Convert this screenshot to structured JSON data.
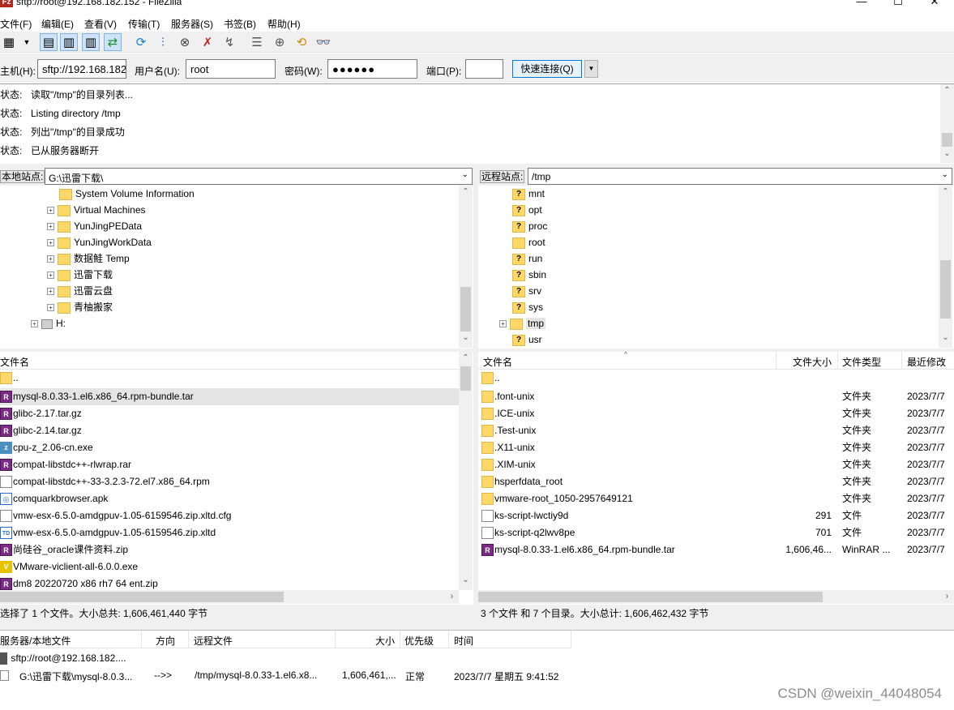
{
  "window": {
    "title": "sftp://root@192.168.182.152 - FileZilla",
    "minimize": "—",
    "maximize": "☐",
    "close": "✕"
  },
  "menu": [
    "文件(F)",
    "编辑(E)",
    "查看(V)",
    "传输(T)",
    "服务器(S)",
    "书签(B)",
    "帮助(H)"
  ],
  "quickconnect": {
    "host_label": "主机(H):",
    "host_value": "sftp://192.168.182",
    "user_label": "用户名(U):",
    "user_value": "root",
    "pass_label": "密码(W):",
    "pass_value": "●●●●●●",
    "port_label": "端口(P):",
    "port_value": "",
    "connect_label": "快速连接(Q)",
    "dropdown": "▼"
  },
  "log": [
    {
      "key": "状态:",
      "text": "读取\"/tmp\"的目录列表..."
    },
    {
      "key": "状态:",
      "text": "Listing directory /tmp"
    },
    {
      "key": "状态:",
      "text": "列出\"/tmp\"的目录成功"
    },
    {
      "key": "状态:",
      "text": "已从服务器断开"
    }
  ],
  "local": {
    "site_label": "本地站点:",
    "path": "G:\\迅雷下载\\",
    "tree": [
      "System Volume Information",
      "Virtual Machines",
      "YunJingPEData",
      "YunJingWorkData",
      "数据鮭 Temp",
      "迅雷下载",
      "迅雷云盘",
      "青柚搬家",
      "H:"
    ],
    "header": {
      "name": "文件名"
    },
    "files": [
      "..",
      "mysql-8.0.33-1.el6.x86_64.rpm-bundle.tar",
      "glibc-2.17.tar.gz",
      "glibc-2.14.tar.gz",
      "cpu-z_2.06-cn.exe",
      "compat-libstdc++-rlwrap.rar",
      "compat-libstdc++-33-3.2.3-72.el7.x86_64.rpm",
      "comquarkbrowser.apk",
      "vmw-esx-6.5.0-amdgpuv-1.05-6159546.zip.xltd.cfg",
      "vmw-esx-6.5.0-amdgpuv-1.05-6159546.zip.xltd",
      "尚硅谷_oracle课件资料.zip",
      "VMware-viclient-all-6.0.0.exe",
      "dm8 20220720 x86 rh7 64 ent.zip"
    ],
    "status": "选择了 1 个文件。大小总共: 1,606,461,440 字节"
  },
  "remote": {
    "site_label": "远程站点:",
    "path": "/tmp",
    "tree": [
      "mnt",
      "opt",
      "proc",
      "root",
      "run",
      "sbin",
      "srv",
      "sys",
      "tmp",
      "usr"
    ],
    "header": {
      "name": "文件名",
      "size": "文件大小",
      "type": "文件类型",
      "modified": "最近修改"
    },
    "files": [
      {
        "name": "..",
        "size": "",
        "type": "",
        "modified": ""
      },
      {
        "name": ".font-unix",
        "size": "",
        "type": "文件夹",
        "modified": "2023/7/7"
      },
      {
        "name": ".ICE-unix",
        "size": "",
        "type": "文件夹",
        "modified": "2023/7/7"
      },
      {
        "name": ".Test-unix",
        "size": "",
        "type": "文件夹",
        "modified": "2023/7/7"
      },
      {
        "name": ".X11-unix",
        "size": "",
        "type": "文件夹",
        "modified": "2023/7/7"
      },
      {
        "name": ".XIM-unix",
        "size": "",
        "type": "文件夹",
        "modified": "2023/7/7"
      },
      {
        "name": "hsperfdata_root",
        "size": "",
        "type": "文件夹",
        "modified": "2023/7/7"
      },
      {
        "name": "vmware-root_1050-2957649121",
        "size": "",
        "type": "文件夹",
        "modified": "2023/7/7"
      },
      {
        "name": "ks-script-lwctiy9d",
        "size": "291",
        "type": "文件",
        "modified": "2023/7/7"
      },
      {
        "name": "ks-script-q2lwv8pe",
        "size": "701",
        "type": "文件",
        "modified": "2023/7/7"
      },
      {
        "name": "mysql-8.0.33-1.el6.x86_64.rpm-bundle.tar",
        "size": "1,606,46...",
        "type": "WinRAR ...",
        "modified": "2023/7/7"
      }
    ],
    "status": "3 个文件 和 7 个目录。大小总计: 1,606,462,432 字节"
  },
  "queue": {
    "headers": {
      "server": "服务器/本地文件",
      "direction": "方向",
      "remote": "远程文件",
      "size": "大小",
      "priority": "优先级",
      "time": "时间"
    },
    "server_row": "sftp://root@192.168.182....",
    "row": {
      "local": "G:\\迅雷下载\\mysql-8.0.3...",
      "direction": "-->>",
      "remote": "/tmp/mysql-8.0.33-1.el6.x8...",
      "size": "1,606,461,...",
      "priority": "正常",
      "time": "2023/7/7 星期五 9:41:52"
    }
  },
  "watermark": "CSDN @weixin_44048054"
}
